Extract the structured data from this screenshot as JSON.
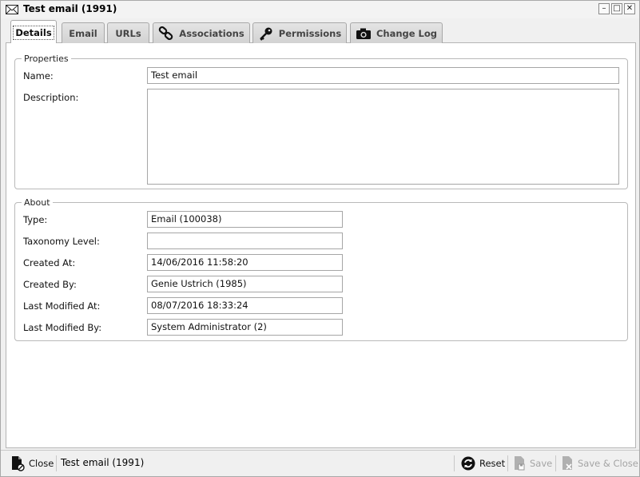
{
  "window": {
    "title": "Test email (1991)",
    "icon": "envelope-icon"
  },
  "tabs": [
    {
      "label": "Details",
      "icon": "",
      "active": true
    },
    {
      "label": "Email",
      "icon": ""
    },
    {
      "label": "URLs",
      "icon": ""
    },
    {
      "label": "Associations",
      "icon": "chain-link-icon"
    },
    {
      "label": "Permissions",
      "icon": "key-icon"
    },
    {
      "label": "Change Log",
      "icon": "camera-icon"
    }
  ],
  "properties": {
    "legend": "Properties",
    "name_label": "Name:",
    "name_value": "Test email",
    "description_label": "Description:",
    "description_value": ""
  },
  "about": {
    "legend": "About",
    "type_label": "Type:",
    "type_value": "Email (100038)",
    "taxonomy_label": "Taxonomy Level:",
    "taxonomy_value": "",
    "created_at_label": "Created At:",
    "created_at_value": "14/06/2016 11:58:20",
    "created_by_label": "Created By:",
    "created_by_value": "Genie Ustrich (1985)",
    "modified_at_label": "Last Modified At:",
    "modified_at_value": "08/07/2016 18:33:24",
    "modified_by_label": "Last Modified By:",
    "modified_by_value": "System Administrator (2)"
  },
  "statusbar": {
    "close_label": "Close",
    "title": "Test email (1991)",
    "reset_label": "Reset",
    "save_label": "Save",
    "save_close_label": "Save & Close"
  }
}
